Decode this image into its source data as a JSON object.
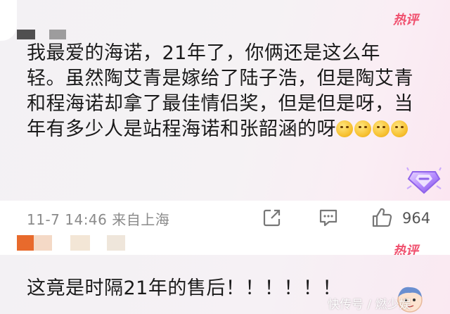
{
  "comment1": {
    "badge": "热评",
    "text": "我最爱的海诺，21年了，你俩还是这么年轻。虽然陶艾青是嫁给了陆子浩，但是陶艾青和程海诺却拿了最佳情侣奖，但是但是呀，当年有多少人是站程海诺和张韶涵的呀",
    "emojis": [
      "thinking-emoji",
      "thinking-emoji",
      "thinking-emoji",
      "thinking-emoji"
    ],
    "timestamp": "11-7 14:46",
    "location": "来自上海",
    "like_count": "964",
    "medal_icon": "diamond-medal-icon"
  },
  "comment2": {
    "badge": "热评",
    "text": "这竟是时隔21年的售后！！！！！！"
  },
  "watermark": "快传号 / 燃少娱",
  "colors": {
    "badge": "#f0506e",
    "text": "#1a1a1a",
    "meta": "#8a8a8a",
    "card_bg": "#f3f1f4"
  }
}
